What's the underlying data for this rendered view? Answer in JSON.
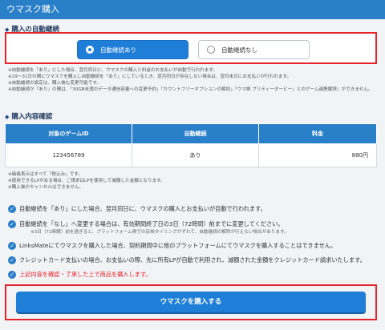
{
  "header": {
    "title": "ウマスク購入"
  },
  "auto_renewal": {
    "section_title": "購入の自動継続",
    "option_on": "自動継続あり",
    "option_off": "自動継続なし",
    "notes": [
      "※自動継続を「あり」にした場合、翌月同日に、ウマスクの購入と料金のお支払いが自動で行われます。",
      "※29～31日の間にウマスクを購入し自動継続を「あり」にしているとき、翌月同日が存在しない場合は、翌月末日にお支払いが行われます。",
      "※自動継続の設定は、購入後も変更可能です。",
      "※自動継続が「あり」の間は、「30GB未満のデータ通信容量への変更予約」「カウントフリーオプションの解約」「ウマ娘 プリティーダービー」とのゲーム連携解除」ができません。"
    ]
  },
  "confirm": {
    "section_title": "購入内容確認",
    "columns": [
      "対象のゲームID",
      "自動継続",
      "料金"
    ],
    "row": {
      "game_id": "123456789",
      "auto": "あり",
      "price": "880円"
    },
    "notes": [
      "※価格表示はすべて「税込み」です。",
      "※使用できるLPがある場合、ご請求はLPを使用して減額した金額となります。",
      "※購入後のキャンセルはできません。"
    ]
  },
  "checklist": {
    "item1": "自動継続を「あり」にした場合、翌月同日に、ウマスクの購入とお支払いが自動で行われます。",
    "item2": "自動継続を「なし」へ変更する場合は、有効期間終了日の3日（72時間）前までに変更してください。",
    "item2_sub": "※3日（72時間）前を過ぎると、プラットフォーム側での反映タイミングがずれて、自動継続の解除が行えない場合があります。",
    "item3": "LinksMateにてウマスクを購入した場合、契約期間中に他のプラットフォームにてウマスクを購入することはできません。",
    "item4": "クレジットカード支払いの場合、お支払いの際、先に所有LPが自動で利用され、減額された金額をクレジットカード請求いたします。",
    "agree": "上記内容を確認・了承した上で商品を購入します。"
  },
  "buy_button": "ウマスクを購入する",
  "colors": {
    "accent": "#2a7fc9",
    "alert": "#e6232a"
  }
}
